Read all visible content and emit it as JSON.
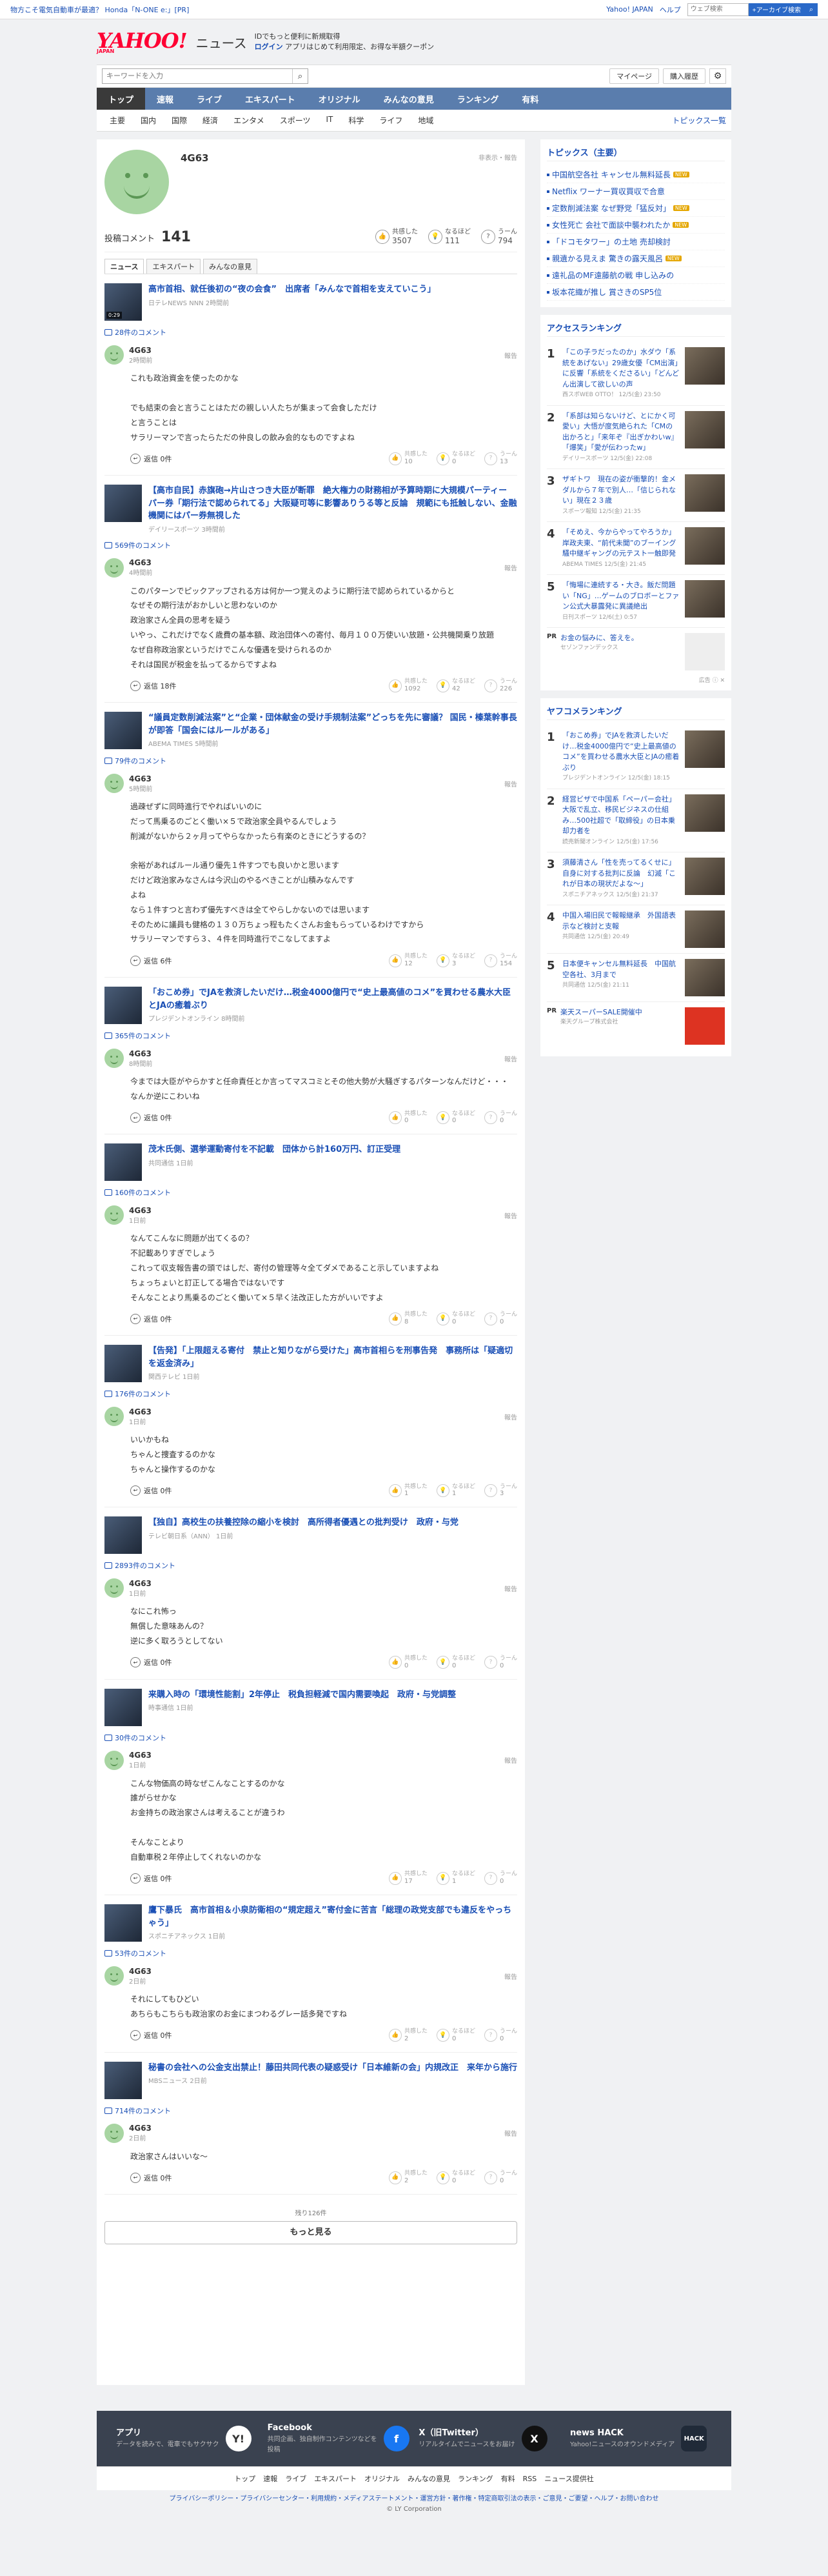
{
  "topbar": {
    "ad": "物方こそ電気自動車が最適？ Honda「N-ONE e:」[PR]",
    "links": [
      "Yahoo! JAPAN",
      "ヘルプ"
    ],
    "search_placeholder": "ウェブ検索",
    "search_btn": "+アーカイブ検索"
  },
  "header": {
    "logo": "YAHOO!",
    "logo_sub": "JAPAN",
    "service": "ニュース",
    "promo1": "IDでもっと便利に新規取得",
    "promo2": "ログイン",
    "promo3": "アプリはじめて利用限定、お得な半額クーポン"
  },
  "search": {
    "placeholder": "キーワードを入力",
    "mypage": "マイページ",
    "purchase": "購入履歴"
  },
  "catnav": [
    "トップ",
    "速報",
    "ライブ",
    "エキスパート",
    "オリジナル",
    "みんなの意見",
    "ランキング",
    "有料"
  ],
  "subnav": {
    "items": [
      "主要",
      "国内",
      "国際",
      "経済",
      "エンタメ",
      "スポーツ",
      "IT",
      "科学",
      "ライフ",
      "地域"
    ],
    "topics": "トピックス一覧"
  },
  "profile": {
    "name": "4G63",
    "meta": "非表示・報告",
    "posts_label": "投稿コメント",
    "posts": "141",
    "reactions": [
      {
        "label": "共感した",
        "value": "3507"
      },
      {
        "label": "なるほど",
        "value": "111"
      },
      {
        "label": "うーん",
        "value": "794"
      }
    ],
    "tabs": [
      "ニュース",
      "エキスパート",
      "みんなの意見"
    ]
  },
  "entries": [
    {
      "title": "高市首相、就任後初の“夜の会食”　出席者「みんなで首相を支えていこう」",
      "source": "日テレNEWS NNN 2時間前",
      "thumb": "0:29",
      "count": "28件のコメント",
      "time": "2時間前",
      "text": "これも政治資金を使ったのかな\n\nでも結束の会と言うことはただの親しい人たちが集まって会食しただけ\nと言うことは\nサラリーマンで言ったらただの仲良しの飲み会的なものですよね",
      "reply": "返信 0件",
      "votes": [
        "10",
        "0",
        "13"
      ]
    },
    {
      "title": "【高市自民】赤旗砲→片山さつき大臣が断罪　絶大権力の財務相が予算時期に大規模パーティー　パー券「期行法で認められてる」大阪疑可等に影響ありうる等と反論　規範にも抵触しない、金融機関にはパー券無視した",
      "source": "デイリースポーツ 3時間前",
      "count": "569件のコメント",
      "time": "4時間前",
      "text": "このパターンでピックアップされる方は何か一つ覚えのように期行法で認められているからと\nなぜその期行法がおかしいと思わないのか\n政治家さん全員の思考を疑う\nいやっ、これだけでなく歳費の基本額、政治団体への寄付、毎月１００万使いい放題・公共機関乗り放題\nなぜ自称政治家というだけでこんな優遇を受けられるのか\nそれは国民が税金を払ってるからですよね",
      "reply": "返信 18件",
      "votes": [
        "1092",
        "42",
        "226"
      ]
    },
    {
      "title": "“議員定数削減法案”と“企業・団体献金の受け手規制法案”どっちを先に審議？ 国民・榛葉幹事長が即答「国会にはルールがある」",
      "source": "ABEMA TIMES 5時間前",
      "count": "79件のコメント",
      "time": "5時間前",
      "text": "過疎ぜずに同時進行でやればいいのに\nだって馬乗るのごとく働い×５で政治家全員やるんでしょう\n削減がないから２ヶ月ってやらなかったら有楽のときにどうするの？\n\n余裕があればルール通り優先１件すつでも良いかと思います\nだけど政治家みなさんは今沢山のやるべきことが山積みなんです\nよね\nなら１件すつと言わず優先すべきは全てやらしかないのでは思います\nそのために議員も健格の１３０万ちょっ程もたくさんお金もらっているわけですから\nサラリーマンですら３、４件を同時進行でこなしてますよ",
      "reply": "返信 6件",
      "votes": [
        "12",
        "3",
        "154"
      ]
    },
    {
      "title": "「おこめ券」でJAを救済したいだけ…税金4000億円で“史上最高値のコメ”を買わせる農水大臣とJAの癒着ぶり",
      "source": "プレジデントオンライン 8時間前",
      "count": "365件のコメント",
      "time": "8時間前",
      "text": "今までは大臣がやらかすと任命責任とか言ってマスコミとその他大勢が大騒ぎするパターンなんだけど・・・\nなんか逆にこわいね",
      "reply": "返信 0件",
      "votes": [
        "0",
        "0",
        "0"
      ]
    },
    {
      "title": "茂木氏側、選挙運動寄付を不記載　団体から計160万円、訂正受理",
      "source": "共同通信 1日前",
      "count": "160件のコメント",
      "time": "1日前",
      "text": "なんてこんなに問題が出てくるの？\n不記載ありすぎでしょう\nこれって収支報告書の頭ではしだ、寄付の管理等々全てダメであること示していますよね\nちょっちょいと訂正してる場合ではないです\nそんなことより馬乗るのごとく働いて×５早く法改正した方がいいですよ",
      "reply": "返信 0件",
      "votes": [
        "8",
        "0",
        "0"
      ]
    },
    {
      "title": "【告発】「上限超える寄付　禁止と知りながら受けた」高市首相らを刑事告発　事務所は「疑適切を返金済み」",
      "source": "関西テレビ 1日前",
      "count": "176件のコメント",
      "time": "1日前",
      "text": "いいかもね\nちゃんと捜査するのかな\nちゃんと操作するのかな",
      "reply": "返信 0件",
      "votes": [
        "1",
        "1",
        "3"
      ]
    },
    {
      "title": "【独自】高校生の扶養控除の縮小を検討　高所得者優遇との批判受け　政府・与党",
      "source": "テレビ朝日系（ANN） 1日前",
      "count": "2893件のコメント",
      "time": "1日前",
      "text": "なにこれ怖っ\n無償した意味あんの？\n逆に多く取ろうとしてない",
      "reply": "返信 0件",
      "votes": [
        "0",
        "0",
        "0"
      ]
    },
    {
      "title": "来購入時の「環境性能割」2年停止　税負担軽減で国内需要喚起　政府・与党調整",
      "source": "時事通信 1日前",
      "count": "30件のコメント",
      "time": "1日前",
      "text": "こんな物価高の時なぜこんなことするのかな\n誰がらせかな\nお金持ちの政治家さんは考えることが違うわ\n\nそんなことより\n自動車税２年停止してくれないのかな",
      "reply": "返信 0件",
      "votes": [
        "17",
        "1",
        "0"
      ]
    },
    {
      "title": "鷹下暴氏　高市首相＆小泉防衛相の“規定超え”寄付金に苦言「総理の政党支部でも違反をやっちゃう」",
      "source": "スポニチアネックス 1日前",
      "count": "53件のコメント",
      "time": "2日前",
      "text": "それにしてもひどい\nあちらもこちらも政治家のお金にまつわるグレー話多発ですね",
      "reply": "返信 0件",
      "votes": [
        "2",
        "0",
        "0"
      ]
    },
    {
      "title": "秘書の会社への公金支出禁止！藤田共同代表の疑惑受け「日本維新の会」内規改正　来年から施行",
      "source": "MBSニュース 2日前",
      "count": "714件のコメント",
      "time": "2日前",
      "text": "政治家さんはいいな〜",
      "reply": "返信 0件",
      "votes": [
        "2",
        "0",
        "0"
      ]
    }
  ],
  "vote_labels": [
    "共感した",
    "なるほど",
    "うーん"
  ],
  "comment_user": "4G63",
  "report_label": "報告",
  "more": {
    "remain": "残り126件",
    "button": "もっと見る"
  },
  "topics": {
    "title": "トピックス（主要）",
    "items": [
      {
        "text": "中国航空各社 キャンセル無料延長",
        "badge": "NEW"
      },
      {
        "text": "Netflix ワーナー買収買収で合意",
        "badge": ""
      },
      {
        "text": "定数削減法案 なぜ野党「猛反対」",
        "badge": "NEW"
      },
      {
        "text": "女性死亡 会社で面談中襲われたか",
        "badge": "NEW"
      },
      {
        "text": "「ドコモタワー」の土地 売却検討",
        "badge": ""
      },
      {
        "text": "親遺かる見えま 驚きの露天風呂",
        "badge": "NEW"
      },
      {
        "text": "遠礼品のMF遠藤航の戦 申し込みの",
        "badge": ""
      },
      {
        "text": "坂本花織が推し 賞さきのSP5位",
        "badge": ""
      }
    ]
  },
  "access": {
    "title": "アクセスランキング",
    "items": [
      {
        "n": "1",
        "t": "「この子ラだったのか」水ダウ「系統をあげない」29歳女優「CM出演」に反響「系統をくださるい」「どんどん出演して欲しいの声",
        "s": "西スポWEB OTTO！ 12/5(金) 23:50"
      },
      {
        "n": "2",
        "t": "「系部は知らないけど、とにかく可愛い」大悟が度気絶られた「CMの出かろと」「来年ぞ『出ぎかわいw』「爆笑」「愛が伝わったw」",
        "s": "デイリースポーツ 12/5(金) 22:08"
      },
      {
        "n": "3",
        "t": "ザギトワ　現在の姿が衝撃的！金メダルから７年で別人…「信じられない」現在２３歳",
        "s": "スポーツ報知 12/5(金) 21:35"
      },
      {
        "n": "4",
        "t": "「そめえ、今からやってやろうか」岸政夫東、“前代未聞”のブーイング騒中継ギャングの元テスト一触即発",
        "s": "ABEMA TIMES 12/5(金) 21:45"
      },
      {
        "n": "5",
        "t": "「悔場に連続する・大き。飯だ問題い「NG」…ゲームのブロボーとファン公式大暴露発に異議絶出",
        "s": "日刊スポーツ 12/6(土) 0:57"
      }
    ],
    "pr": {
      "label": "PR",
      "t": "お金の悩みに、答えを。",
      "s": "セゾンファンデックス"
    },
    "adfoot": "広告 ⓘ ✕"
  },
  "yafoo": {
    "title": "ヤフコメランキング",
    "items": [
      {
        "n": "1",
        "t": "「おこめ券」でJAを救済したいだけ…税金4000億円で“史上最高値のコメ”を買わせる農水大臣とJAの癒着ぶり",
        "s": "プレジデントオンライン 12/5(金) 18:15"
      },
      {
        "n": "2",
        "t": "経営ビザで中国系「ペーパー会社」大阪で乱立、移民ビジネスの仕組み…500社超で「取締役」の日本乗却力者を",
        "s": "読売新聞オンライン 12/5(金) 17:56"
      },
      {
        "n": "3",
        "t": "須藤清さん「性を売ってるくせに」自身に対する批判に反論　幻滅「これが日本の現状だよな～」",
        "s": "スポニチアネックス 12/5(金) 21:37"
      },
      {
        "n": "4",
        "t": "中国入場旧民で報報継承　外国語表示など検討と支報",
        "s": "共同通信 12/5(金) 20:49"
      },
      {
        "n": "5",
        "t": "日本便キャンセル無料延長　中国航空各社、3月まで",
        "s": "共同通信 12/5(金) 21:11"
      }
    ],
    "pr": {
      "label": "PR",
      "t": "楽天スーパーSALE開催中",
      "s": "楽天グループ株式会社"
    }
  },
  "footer": {
    "cards": [
      {
        "title": "アプリ",
        "desc": "データを読みで、電車でもサクサク",
        "icon": "Y!"
      },
      {
        "title": "Facebook",
        "desc": "共同企画、独自制作コンテンツなどを投稿",
        "icon": "f"
      },
      {
        "title": "X（旧Twitter）",
        "desc": "リアルタイムでニュースをお届け",
        "icon": "X"
      },
      {
        "title": "news HACK",
        "desc": "Yahoo!ニュースのオウンドメディア",
        "icon": "HACK"
      }
    ],
    "links": [
      "トップ",
      "速報",
      "ライブ",
      "エキスパート",
      "オリジナル",
      "みんなの意見",
      "ランキング",
      "有料",
      "RSS",
      "ニュース提供社"
    ],
    "legal": "プライバシーポリシー・プライバシーセンター・利用規約・メディアステートメント・運営方針・著作権・特定商取引法の表示・ご意見・ご要望・ヘルプ・お問い合わせ",
    "copyright": "© LY Corporation"
  }
}
